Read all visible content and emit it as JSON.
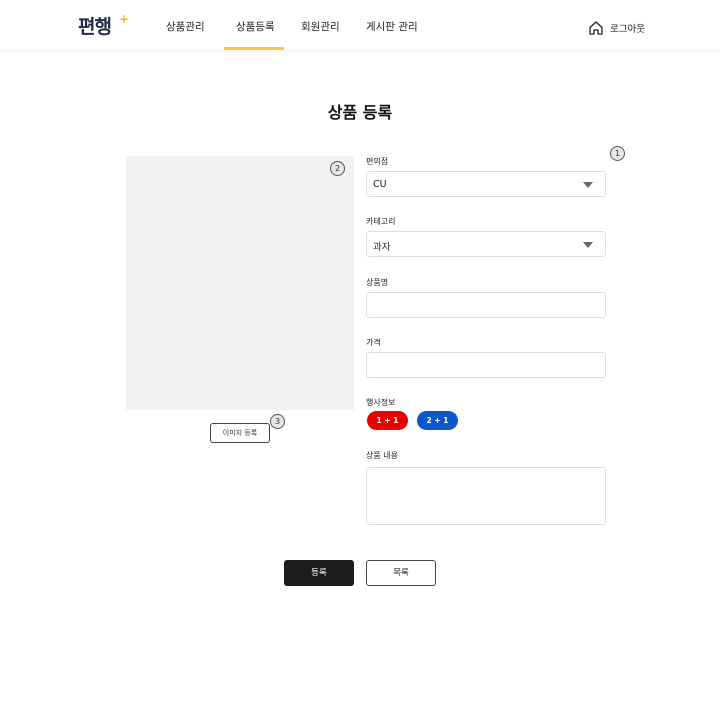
{
  "header": {
    "logo": "편행",
    "logo_plus": "+",
    "nav": [
      {
        "label": "상품관리"
      },
      {
        "label": "상품등록"
      },
      {
        "label": "회원관리"
      },
      {
        "label": "게시판 관리"
      }
    ],
    "logout_label": "로그아웃",
    "active_nav": "상품등록"
  },
  "page": {
    "title": "상품 등록"
  },
  "image_panel": {
    "register_button": "이미지 등록"
  },
  "markers": [
    "1",
    "2",
    "3"
  ],
  "form": {
    "store": {
      "label": "편의점",
      "value": "CU"
    },
    "category": {
      "label": "카테고리",
      "value": "과자"
    },
    "product_name": {
      "label": "상품명",
      "value": ""
    },
    "price": {
      "label": "가격",
      "value": ""
    },
    "event": {
      "label": "행사정보",
      "options": [
        "1 + 1",
        "2 + 1"
      ]
    },
    "description": {
      "label": "상품 내용",
      "value": ""
    }
  },
  "actions": {
    "submit": "등록",
    "list": "목록"
  },
  "colors": {
    "accent": "#f7c948",
    "pill_1plus1": "#e60000",
    "pill_2plus1": "#0a58c9",
    "dark_button": "#1c1c1c"
  }
}
